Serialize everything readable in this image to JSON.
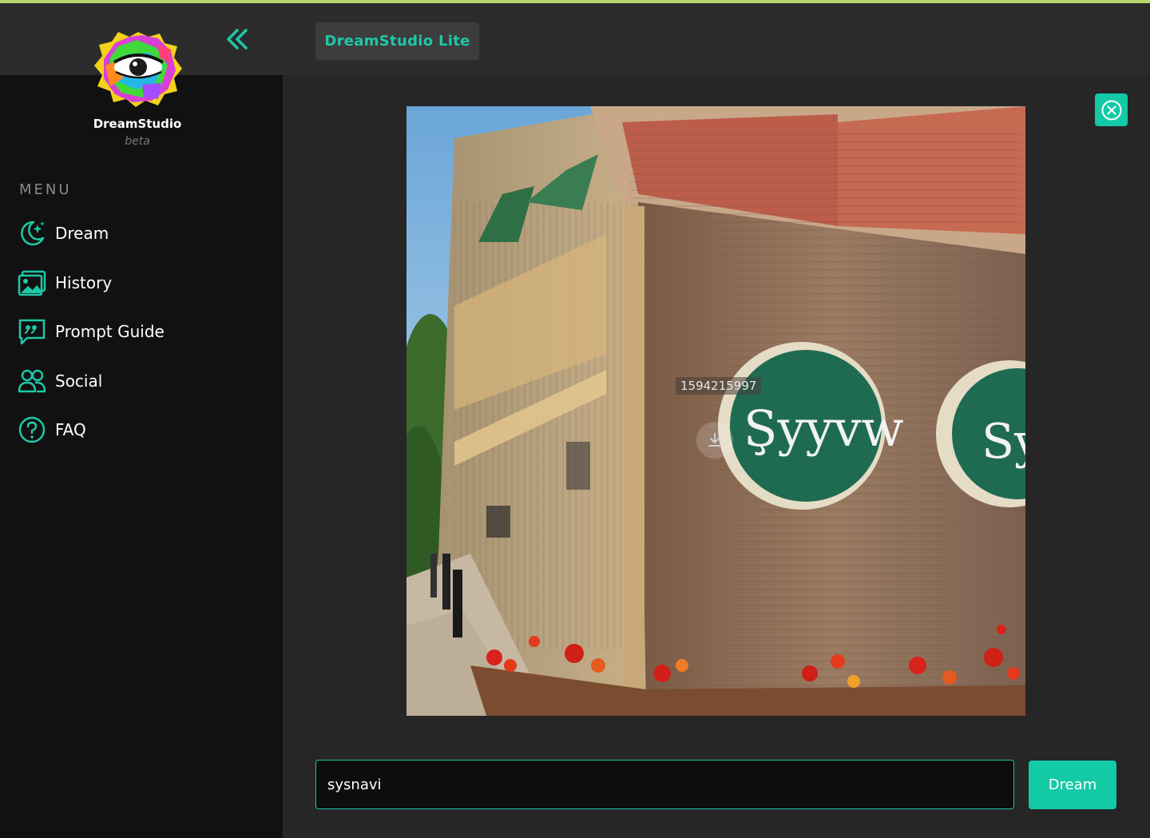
{
  "brand": {
    "name": "DreamStudio",
    "subtitle": "beta",
    "logo_icon": "paint-splash-eye-icon"
  },
  "header": {
    "app_title": "DreamStudio Lite",
    "collapse_icon": "double-chevron-left-icon"
  },
  "sidebar": {
    "menu_label": "MENU",
    "items": [
      {
        "label": "Dream",
        "icon": "moon-stars-icon"
      },
      {
        "label": "History",
        "icon": "image-gallery-icon"
      },
      {
        "label": "Prompt Guide",
        "icon": "quote-bubble-icon"
      },
      {
        "label": "Social",
        "icon": "users-icon"
      },
      {
        "label": "FAQ",
        "icon": "question-circle-icon"
      }
    ]
  },
  "viewer": {
    "seed": "1594215997",
    "image_sign_text": "Şyyvw",
    "close_icon": "close-circle-icon",
    "download_icon": "download-icon"
  },
  "prompt": {
    "value": "sysnavi",
    "submit_label": "Dream"
  },
  "colors": {
    "accent": "#14c9a6",
    "accent_text": "#1dc8a8",
    "sidebar_bg": "#111111",
    "main_bg": "#262626",
    "topbar_bg": "#2c2c2c",
    "top_border": "#b9d66a"
  }
}
